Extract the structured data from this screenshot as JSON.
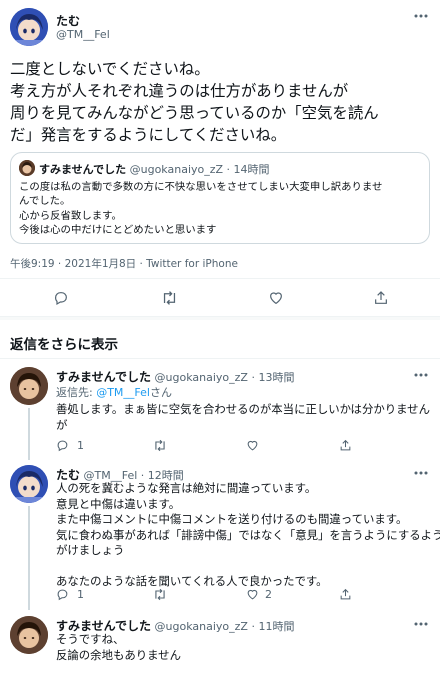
{
  "main_tweet": {
    "author_name": "たむ",
    "author_handle": "@TM__Fel",
    "text_lines": [
      "二度としないでくださいね。",
      "考え方が人それぞれ違うのは仕方がありませんが",
      "周りを見てみんながどう思っているのか「空気を読ん",
      "だ」発言をするようにしてくださいね。"
    ],
    "quoted": {
      "author_name": "すみませんでした",
      "author_handle": "@ugokanaiyo_zZ",
      "time": "14時間",
      "text_lines": [
        "この度は私の言動で多数の方に不快な思いをさせてしまい大変申し訳ありませ",
        "んでした。",
        "心から反省致します。",
        "今後は心の中だけにとどめたいと思います"
      ]
    },
    "meta": "午後9:19 · 2021年1月8日 · Twitter for iPhone"
  },
  "show_more_replies": "返信をさらに表示",
  "replies": [
    {
      "author_name": "すみませんでした",
      "author_handle": "@ugokanaiyo_zZ",
      "time": "13時間",
      "reply_to_prefix": "返信先: ",
      "reply_to_handle": "@TM__Fel",
      "reply_to_suffix": "さん",
      "text_lines": [
        "善処します。まぁ皆に空気を合わせるのが本当に正しいかは分かりません",
        "が"
      ],
      "reply_count": "1",
      "retweet_count": "",
      "like_count": ""
    },
    {
      "author_name": "たむ",
      "author_handle": "@TM__Fel",
      "time": "12時間",
      "text_lines": [
        "人の死を冀むような発言は絶対に間違っています。",
        "意見と中傷は違います。",
        "また中傷コメントに中傷コメントを送り付けるのも間違っています。",
        "気に食わぬ事があれば「誹謗中傷」ではなく「意見」を言うようにするよう心",
        "がけましょう",
        "",
        "あなたのような話を聞いてくれる人で良かったです。"
      ],
      "reply_count": "1",
      "retweet_count": "",
      "like_count": "2"
    },
    {
      "author_name": "すみませんでした",
      "author_handle": "@ugokanaiyo_zZ",
      "time": "11時間",
      "text_lines": [
        "そうですね、",
        "反論の余地もありません"
      ]
    }
  ],
  "icons": {
    "reply": "reply-icon",
    "retweet": "retweet-icon",
    "like": "like-icon",
    "share": "share-icon"
  },
  "colors": {
    "text": "#0f1419",
    "muted": "#536471",
    "link": "#1d9bf0",
    "divider": "#eff3f4"
  }
}
